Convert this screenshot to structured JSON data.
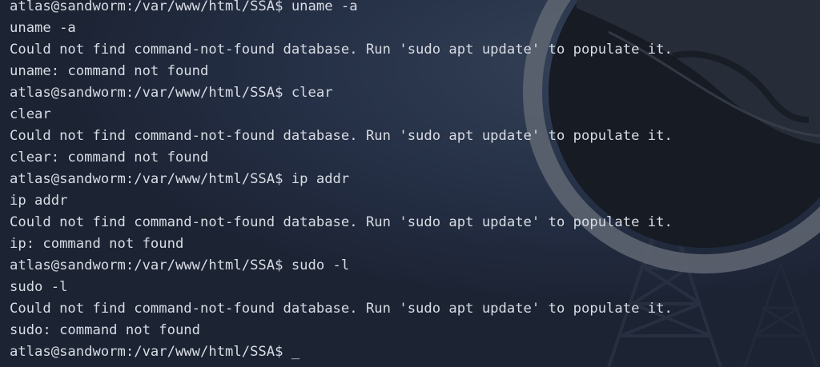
{
  "terminal": {
    "lines": [
      "atlas@sandworm:/var/www/html/SSA$ uname -a",
      "uname -a",
      "Could not find command-not-found database. Run 'sudo apt update' to populate it.",
      "uname: command not found",
      "atlas@sandworm:/var/www/html/SSA$ clear",
      "clear",
      "Could not find command-not-found database. Run 'sudo apt update' to populate it.",
      "clear: command not found",
      "atlas@sandworm:/var/www/html/SSA$ ip addr",
      "ip addr",
      "Could not find command-not-found database. Run 'sudo apt update' to populate it.",
      "ip: command not found",
      "atlas@sandworm:/var/www/html/SSA$ sudo -l",
      "sudo -l",
      "Could not find command-not-found database. Run 'sudo apt update' to populate it.",
      "sudo: command not found"
    ],
    "prompt": "atlas@sandworm:/var/www/html/SSA$ ",
    "cursor": "_"
  },
  "colors": {
    "background": "#1f2737",
    "text": "#d8dce4",
    "wallpaper_ring": "#5d6470"
  }
}
